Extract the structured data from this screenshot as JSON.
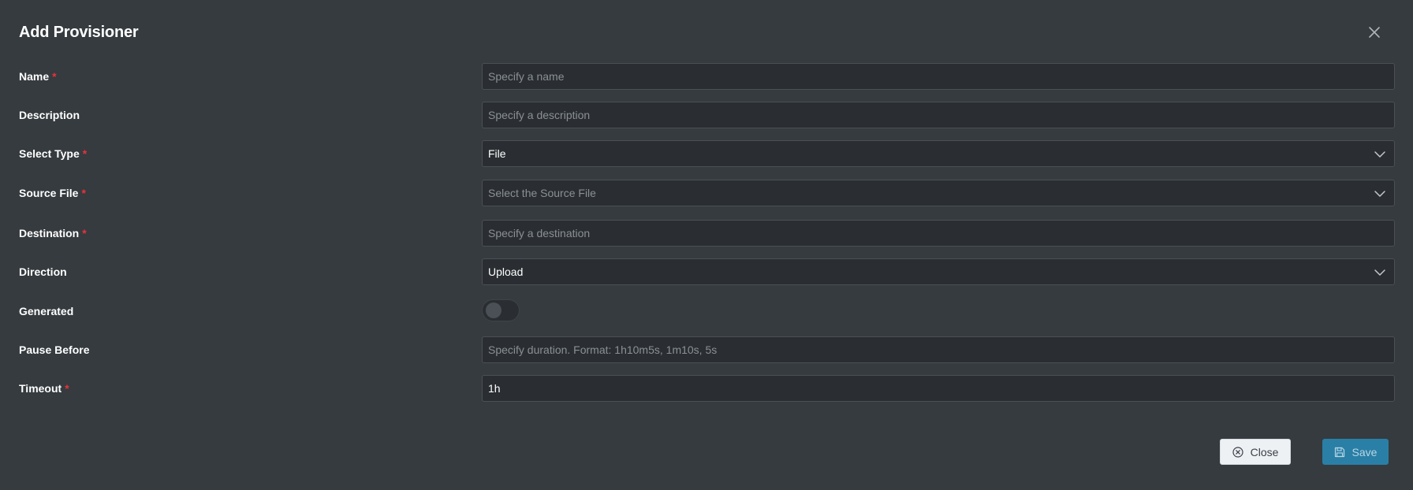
{
  "dialog": {
    "title": "Add Provisioner"
  },
  "fields": {
    "name": {
      "label": "Name",
      "required_mark": "*",
      "value": "",
      "placeholder": "Specify a name"
    },
    "description": {
      "label": "Description",
      "value": "",
      "placeholder": "Specify a description"
    },
    "select_type": {
      "label": "Select Type",
      "required_mark": "*",
      "value": "File"
    },
    "source_file": {
      "label": "Source File",
      "required_mark": "*",
      "placeholder": "Select the Source File"
    },
    "destination": {
      "label": "Destination",
      "required_mark": "*",
      "value": "",
      "placeholder": "Specify a destination"
    },
    "direction": {
      "label": "Direction",
      "value": "Upload"
    },
    "generated": {
      "label": "Generated",
      "on": false
    },
    "pause_before": {
      "label": "Pause Before",
      "value": "",
      "placeholder": "Specify duration. Format: 1h10m5s, 1m10s, 5s"
    },
    "timeout": {
      "label": "Timeout",
      "required_mark": "*",
      "value": "1h"
    }
  },
  "footer": {
    "close_label": "Close",
    "save_label": "Save"
  },
  "icons": {
    "dialog_close": "close-icon",
    "select_caret": "chevron-down-icon",
    "close_button": "circle-x-icon",
    "save_button": "floppy-disk-icon"
  },
  "colors": {
    "background": "#353b3f",
    "field_background": "#2a2e32",
    "required": "#e8323c",
    "primary": "#2a7fa6"
  }
}
